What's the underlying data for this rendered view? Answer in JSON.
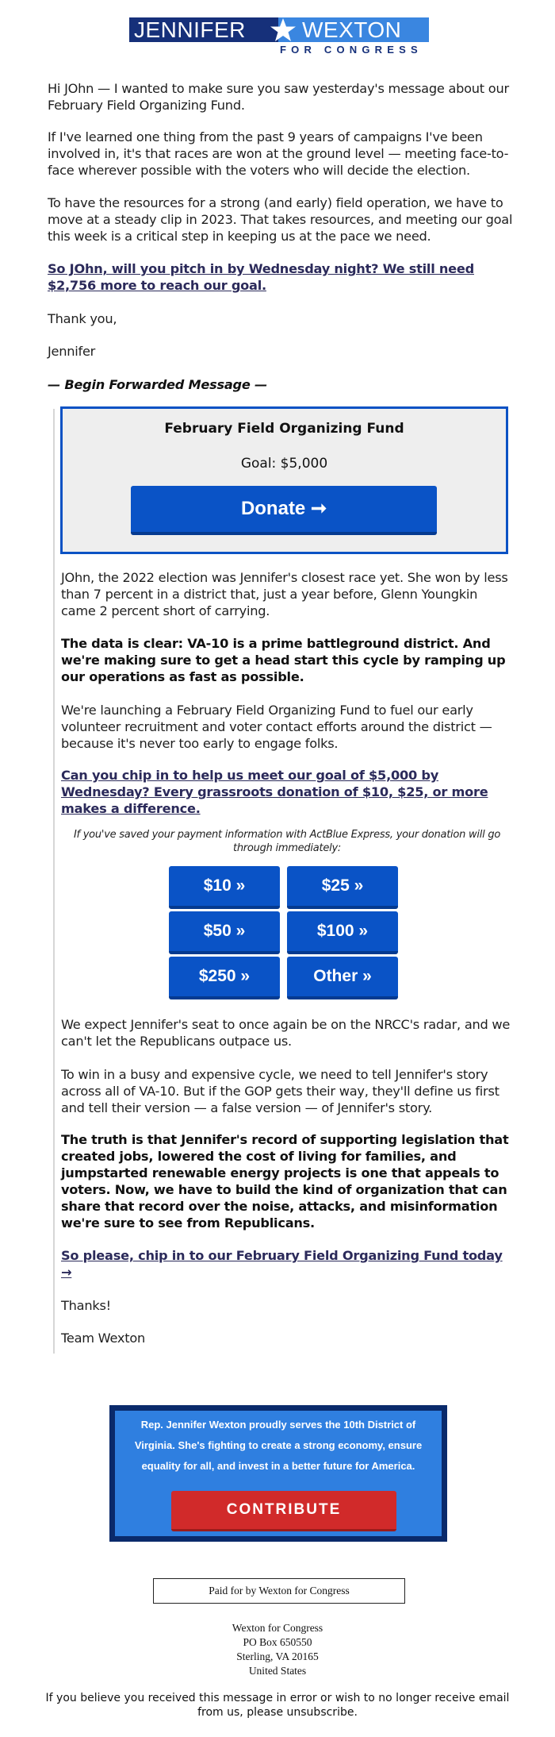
{
  "logo": {
    "first_name": "JENNIFER",
    "last_name": "WEXTON",
    "tagline": "FOR CONGRESS",
    "icon": "star-icon",
    "colors": {
      "dark": "#16307a",
      "light": "#3a86e0"
    }
  },
  "intro": {
    "p1": "Hi JOhn — I wanted to make sure you saw yesterday's message about our February Field Organizing Fund.",
    "p2": "If I've learned one thing from the past 9 years of campaigns I've been involved in, it's that races are won at the ground level — meeting face-to-face wherever possible with the voters who will decide the election.",
    "p3": "To have the resources for a strong (and early) field operation, we have to move at a steady clip in 2023. That takes resources, and meeting our goal this week is a critical step in keeping us at the pace we need.",
    "cta_link": "So JOhn, will you pitch in by Wednesday night? We still need $2,756 more to reach our goal.",
    "signoff": "Thank you,",
    "signature": "Jennifer",
    "forward_header": "— Begin Forwarded Message —"
  },
  "fund_box": {
    "title": "February Field Organizing Fund",
    "goal": "Goal: $5,000",
    "donate_label": "Donate ➞",
    "colors": {
      "border": "#0b52c4",
      "background": "#eeeeee",
      "button": "#0a53c6"
    }
  },
  "forwarded": {
    "p1": "JOhn, the 2022 election was Jennifer's closest race yet. She won by less than 7 percent in a district that, just a year before, Glenn Youngkin came 2 percent short of carrying.",
    "p2_bold": "The data is clear: VA-10 is a prime battleground district. And we're making sure to get a head start this cycle by ramping up our operations as fast as possible.",
    "p3": "We're launching a February Field Organizing Fund to fuel our early volunteer recruitment and voter contact efforts around the district — because it's never too early to engage folks.",
    "cta_link": "Can you chip in to help us meet our goal of $5,000 by Wednesday? Every grassroots donation of $10, $25, or more makes a difference.",
    "express_note": "If you've saved your payment information with ActBlue Express, your donation will go through immediately:",
    "amounts": [
      "$10 »",
      "$25 »",
      "$50 »",
      "$100 »",
      "$250 »",
      "Other »"
    ],
    "p4": "We expect Jennifer's seat to once again be on the NRCC's radar, and we can't let the Republicans outpace us.",
    "p5": "To win in a busy and expensive cycle, we need to tell Jennifer's story across all of VA-10. But if the GOP gets their way, they'll define us first and tell their version — a false version — of Jennifer's story.",
    "p6_bold": "The truth is that Jennifer's record of supporting legislation that created jobs, lowered the cost of living for families, and jumpstarted renewable energy projects is one that appeals to voters. Now, we have to build the kind of organization that can share that record over the noise, attacks, and misinformation we're sure to see from Republicans.",
    "final_link": "So please, chip in to our February Field Organizing Fund today →",
    "thanks": "Thanks!",
    "team": "Team Wexton"
  },
  "footer": {
    "blurb": "Rep. Jennifer Wexton proudly serves the 10th District of Virginia. She's fighting to create a strong economy, ensure equality for all, and invest in a better future for America.",
    "contribute_label": "CONTRIBUTE",
    "paid_for": "Paid for by Wexton for Congress",
    "address": [
      "Wexton for Congress",
      "PO Box 650550",
      "Sterling, VA 20165",
      "United States"
    ],
    "unsubscribe_note": "If you believe you received this message in error or wish to no longer receive email from us, please unsubscribe.",
    "colors": {
      "outer": "#0a2a6b",
      "inner": "#2f7fe0",
      "button": "#d12a2a"
    }
  }
}
